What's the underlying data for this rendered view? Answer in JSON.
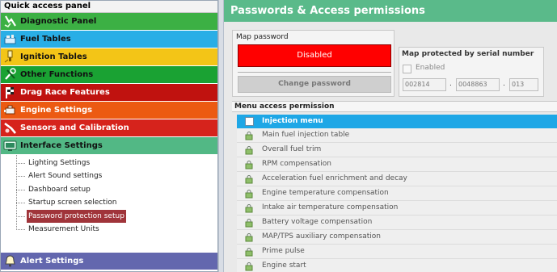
{
  "quick_access": {
    "title": "Quick access panel",
    "categories_top": [
      {
        "label": "Diagnostic Panel",
        "color": "#3cb044",
        "icon": "stethoscope-icon"
      },
      {
        "label": "Fuel Tables",
        "color": "#29aee6",
        "icon": "fuel-icon"
      },
      {
        "label": "Ignition Tables",
        "color": "#f3c517",
        "icon": "spark-icon"
      },
      {
        "label": "Other Functions",
        "color": "#1aa233",
        "icon": "tools-icon"
      },
      {
        "label": "Drag Race Features",
        "color": "#c0120f",
        "icon": "flag-icon"
      },
      {
        "label": "Engine Settings",
        "color": "#ec5a12",
        "icon": "engine-icon"
      },
      {
        "label": "Sensors and Calibration",
        "color": "#d6231c",
        "icon": "sensor-icon"
      },
      {
        "label": "Interface Settings",
        "color": "#52b885",
        "icon": "monitor-icon"
      }
    ],
    "interface_items": [
      "Lighting Settings",
      "Alert Sound settings",
      "Dashboard setup",
      "Startup screen selection",
      "Password protection setup",
      "Measurement Units"
    ],
    "selected_item": "Password protection setup",
    "alert_settings": {
      "label": "Alert Settings",
      "color": "#6367ae",
      "icon": "alert-icon"
    }
  },
  "panel": {
    "title": "Passwords & Access permissions",
    "map_password": {
      "label": "Map password",
      "status_button": "Disabled",
      "change_button": "Change password"
    },
    "serial": {
      "title": "Map protected by serial number",
      "enabled_label": "Enabled",
      "enabled": false,
      "field1": "002814",
      "field2": "0048863",
      "field3": "013"
    },
    "menu_access": {
      "label": "Menu access permission",
      "header": "Injection menu",
      "items": [
        "Main fuel injection table",
        "Overall fuel trim",
        "RPM compensation",
        "Acceleration fuel enrichment and decay",
        "Engine temperature compensation",
        "Intake air temperature compensation",
        "Battery voltage compensation",
        "MAP/TPS auxiliary compensation",
        "Prime pulse",
        "Engine start"
      ]
    }
  },
  "colors": {
    "header_green": "#5aba8a",
    "disabled_red": "#ff0000",
    "list_header_blue": "#1ea7e6",
    "selected_item": "#a0343a"
  }
}
